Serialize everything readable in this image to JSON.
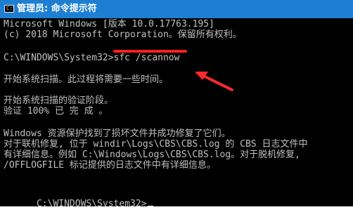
{
  "window": {
    "title": "管理员: 命令提示符",
    "icon_text": "C:\\"
  },
  "console": {
    "lines": [
      "Microsoft Windows [版本 10.0.17763.195]",
      "(c) 2018 Microsoft Corporation。保留所有权利。",
      "",
      "C:\\WINDOWS\\System32>sfc /scannow",
      "",
      "开始系统扫描。此过程将需要一些时间。",
      "",
      "开始系统扫描的验证阶段。",
      "验证 100% 已 完 成 。",
      "",
      "Windows 资源保护找到了损坏文件并成功修复了它们。",
      "对于联机修复, 位于 windir\\Logs\\CBS\\CBS.log 的 CBS 日志文件中",
      "有详细信息。例如 C:\\Windows\\Logs\\CBS\\CBS.log。对于脱机修复,",
      "/OFFLOGFILE 标记提供的日志文件中有详细信息。",
      "",
      "C:\\WINDOWS\\System32>"
    ]
  },
  "annotation": {
    "color": "#ff2a2a"
  }
}
